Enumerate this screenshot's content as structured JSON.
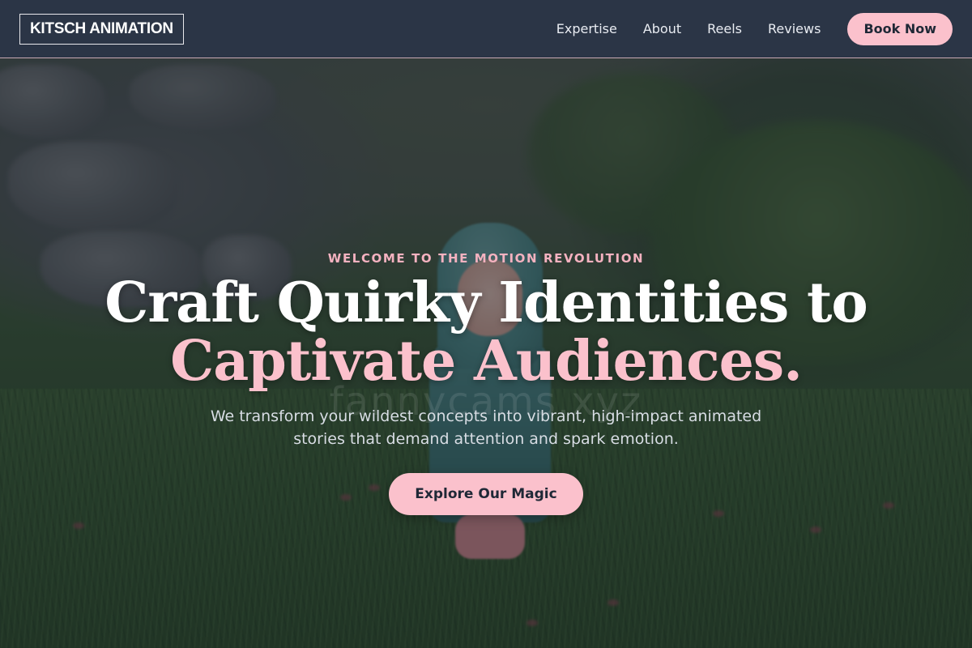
{
  "brand": {
    "logo_text": "KITSCH ANIMATION"
  },
  "nav": {
    "links": [
      {
        "label": "Expertise"
      },
      {
        "label": "About"
      },
      {
        "label": "Reels"
      },
      {
        "label": "Reviews"
      }
    ],
    "book_label": "Book Now"
  },
  "hero": {
    "eyebrow": "WELCOME TO THE MOTION REVOLUTION",
    "headline_line1": "Craft Quirky Identities to",
    "headline_line2": "Captivate Audiences.",
    "watermark": "fannycams.xyz",
    "subtitle": "We transform your wildest concepts into vibrant, high-impact animated stories that demand attention and spark emotion.",
    "cta_label": "Explore Our Magic"
  },
  "colors": {
    "navbar_bg": "#2b3546",
    "accent_pink": "#fbc1cc",
    "eyebrow_pink": "#f5b2c0",
    "text_white": "#ffffff"
  }
}
